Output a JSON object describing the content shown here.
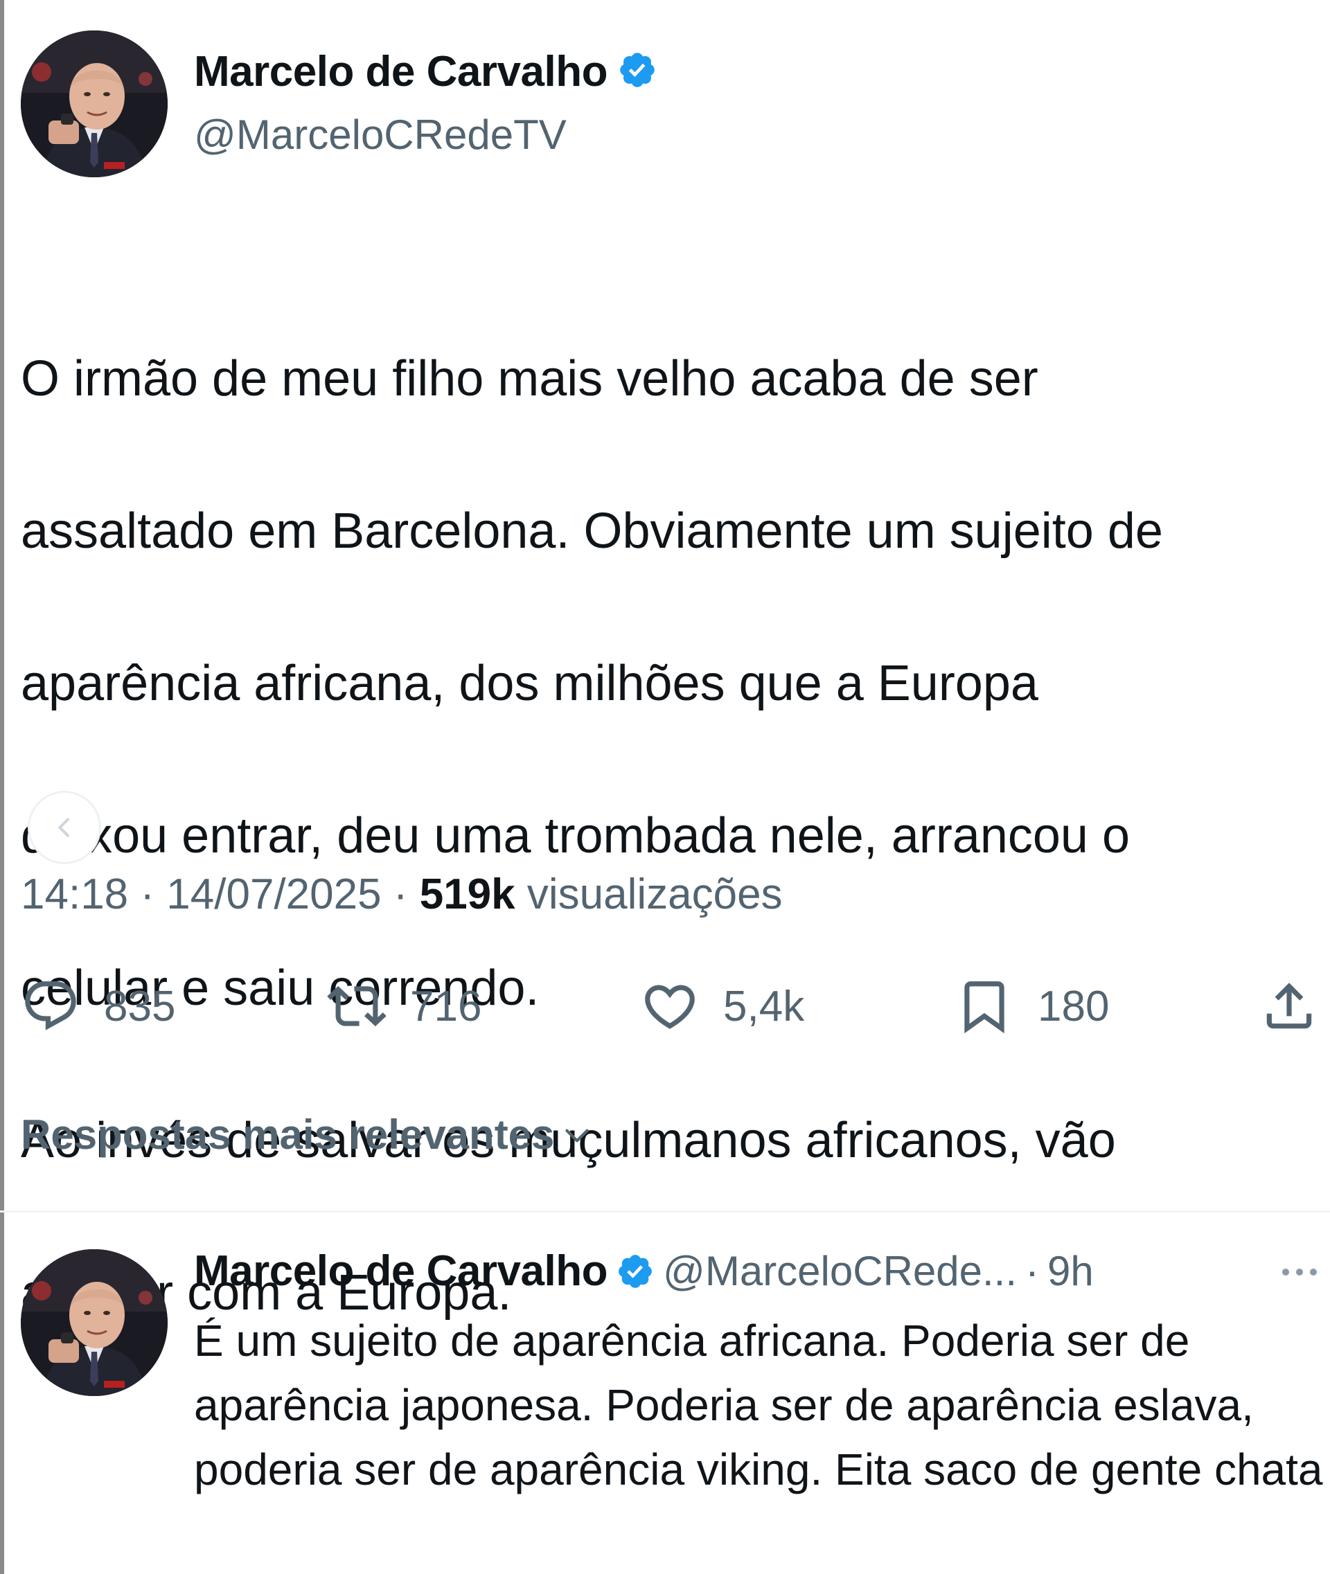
{
  "tweet": {
    "author_name": "Marcelo de Carvalho",
    "author_handle": "@MarceloCRedeTV",
    "text_lines": [
      "O irmão de meu filho mais velho acaba de ser",
      "assaltado em Barcelona. Obviamente um sujeito de",
      "aparência africana, dos milhões que a Europa",
      "deixou entrar, deu uma trombada nele, arrancou o",
      "celular e saiu correndo.",
      "Ao invés de salvar os muçulmanos africanos, vão",
      "acabar com a Europa."
    ],
    "time": "14:18",
    "separator": "·",
    "date": "14/07/2025",
    "views_count": "519k",
    "views_label": "visualizações",
    "stats": {
      "replies": "835",
      "retweets": "716",
      "likes": "5,4k",
      "bookmarks": "180"
    }
  },
  "replies_sort": {
    "label": "Respostas mais relevantes"
  },
  "reply": {
    "author_name": "Marcelo de Carvalho",
    "author_handle": "@MarceloCRede...",
    "separator": "·",
    "time": "9h",
    "text": "É um sujeito de aparência africana. Poderia ser de aparência japonesa. Poderia ser de aparência eslava, poderia ser de aparência viking. Eita saco de gente chata"
  },
  "colors": {
    "text_primary": "#0f1419",
    "text_secondary": "#536471",
    "verified_blue": "#1d9bf0",
    "divider": "#eff3f4"
  },
  "icons": {
    "verified": "verified-badge-icon",
    "reply": "reply-icon",
    "retweet": "retweet-icon",
    "like": "heart-icon",
    "bookmark": "bookmark-icon",
    "share": "share-icon",
    "back": "chevron-left-icon",
    "sort": "chevron-down-icon",
    "more": "more-icon"
  }
}
